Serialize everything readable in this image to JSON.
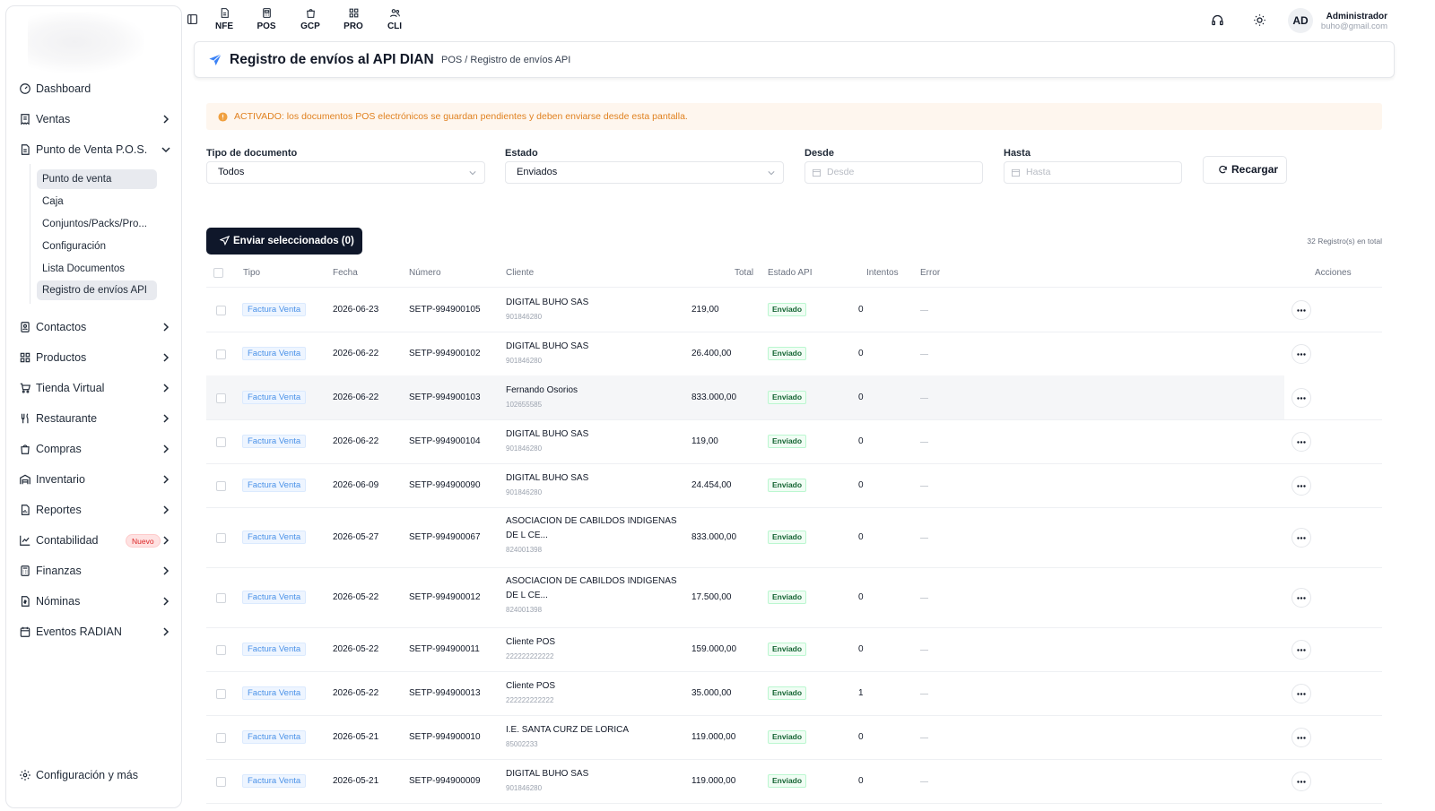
{
  "topbar": {
    "modules": [
      {
        "label": "NFE",
        "icon": "document-icon"
      },
      {
        "label": "POS",
        "icon": "pos-icon"
      },
      {
        "label": "GCP",
        "icon": "bag-icon"
      },
      {
        "label": "PRO",
        "icon": "grid-icon"
      },
      {
        "label": "CLI",
        "icon": "users-icon"
      }
    ],
    "user": {
      "initials": "AD",
      "name": "Administrador",
      "email": "buho@gmail.com"
    }
  },
  "sidebar": {
    "items": [
      {
        "label": "Dashboard",
        "icon": "dashboard-icon"
      },
      {
        "label": "Ventas",
        "icon": "receipt-icon"
      },
      {
        "label": "Punto de Venta P.O.S.",
        "icon": "document-icon",
        "expanded": true
      },
      {
        "label": "Contactos",
        "icon": "contacts-icon"
      },
      {
        "label": "Productos",
        "icon": "grid-icon"
      },
      {
        "label": "Tienda Virtual",
        "icon": "cart-icon"
      },
      {
        "label": "Restaurante",
        "icon": "utensils-icon"
      },
      {
        "label": "Compras",
        "icon": "bag-icon"
      },
      {
        "label": "Inventario",
        "icon": "warehouse-icon"
      },
      {
        "label": "Reportes",
        "icon": "report-icon"
      },
      {
        "label": "Contabilidad",
        "icon": "chart-icon",
        "badge": "Nuevo"
      },
      {
        "label": "Finanzas",
        "icon": "calculator-icon"
      },
      {
        "label": "Nóminas",
        "icon": "payroll-icon"
      },
      {
        "label": "Eventos RADIAN",
        "icon": "calendar-icon"
      }
    ],
    "subitems": [
      "Punto de venta",
      "Caja",
      "Conjuntos/Packs/Pro...",
      "Configuración",
      "Lista Documentos",
      "Registro de envíos API"
    ],
    "footer": "Configuración y más"
  },
  "header": {
    "title": "Registro de envíos al API DIAN",
    "breadcrumb": "POS / Registro de envíos API"
  },
  "alert": {
    "text": "ACTIVADO: los documentos POS electrónicos se guardan pendientes y deben enviarse desde esta pantalla."
  },
  "filters": {
    "tipo_label": "Tipo de documento",
    "tipo_value": "Todos",
    "estado_label": "Estado",
    "estado_value": "Enviados",
    "desde_label": "Desde",
    "desde_placeholder": "Desde",
    "hasta_label": "Hasta",
    "hasta_placeholder": "Hasta",
    "reload_label": "Recargar"
  },
  "actions": {
    "send_label": "Enviar seleccionados (0)",
    "total_label": "32 Registro(s) en total"
  },
  "table": {
    "columns": {
      "tipo": "Tipo",
      "fecha": "Fecha",
      "numero": "Número",
      "cliente": "Cliente",
      "total": "Total",
      "estado": "Estado API",
      "intentos": "Intentos",
      "error": "Error",
      "acciones": "Acciones"
    },
    "rows": [
      {
        "tipo": "Factura Venta",
        "fecha": "2026-06-23",
        "numero": "SETP-994900105",
        "cliente": "DIGITAL BUHO SAS",
        "nit": "901846280",
        "total": "219,00",
        "estado": "Enviado",
        "intentos": "0"
      },
      {
        "tipo": "Factura Venta",
        "fecha": "2026-06-22",
        "numero": "SETP-994900102",
        "cliente": "DIGITAL BUHO SAS",
        "nit": "901846280",
        "total": "26.400,00",
        "estado": "Enviado",
        "intentos": "0"
      },
      {
        "tipo": "Factura Venta",
        "fecha": "2026-06-22",
        "numero": "SETP-994900103",
        "cliente": "Fernando Osorios",
        "nit": "102655585",
        "total": "833.000,00",
        "estado": "Enviado",
        "intentos": "0"
      },
      {
        "tipo": "Factura Venta",
        "fecha": "2026-06-22",
        "numero": "SETP-994900104",
        "cliente": "DIGITAL BUHO SAS",
        "nit": "901846280",
        "total": "119,00",
        "estado": "Enviado",
        "intentos": "0"
      },
      {
        "tipo": "Factura Venta",
        "fecha": "2026-06-09",
        "numero": "SETP-994900090",
        "cliente": "DIGITAL BUHO SAS",
        "nit": "901846280",
        "total": "24.454,00",
        "estado": "Enviado",
        "intentos": "0"
      },
      {
        "tipo": "Factura Venta",
        "fecha": "2026-05-27",
        "numero": "SETP-994900067",
        "cliente": "ASOCIACION DE CABILDOS INDIGENAS DE L CE...",
        "nit": "824001398",
        "total": "833.000,00",
        "estado": "Enviado",
        "intentos": "0"
      },
      {
        "tipo": "Factura Venta",
        "fecha": "2026-05-22",
        "numero": "SETP-994900012",
        "cliente": "ASOCIACION DE CABILDOS INDIGENAS DE L CE...",
        "nit": "824001398",
        "total": "17.500,00",
        "estado": "Enviado",
        "intentos": "0"
      },
      {
        "tipo": "Factura Venta",
        "fecha": "2026-05-22",
        "numero": "SETP-994900011",
        "cliente": "Cliente POS",
        "nit": "222222222222",
        "total": "159.000,00",
        "estado": "Enviado",
        "intentos": "0"
      },
      {
        "tipo": "Factura Venta",
        "fecha": "2026-05-22",
        "numero": "SETP-994900013",
        "cliente": "Cliente POS",
        "nit": "222222222222",
        "total": "35.000,00",
        "estado": "Enviado",
        "intentos": "1"
      },
      {
        "tipo": "Factura Venta",
        "fecha": "2026-05-21",
        "numero": "SETP-994900010",
        "cliente": "I.E. SANTA CURZ DE LORICA",
        "nit": "85002233",
        "total": "119.000,00",
        "estado": "Enviado",
        "intentos": "0"
      },
      {
        "tipo": "Factura Venta",
        "fecha": "2026-05-21",
        "numero": "SETP-994900009",
        "cliente": "DIGITAL BUHO SAS",
        "nit": "901846280",
        "total": "119.000,00",
        "estado": "Enviado",
        "intentos": "0"
      }
    ]
  },
  "colors": {
    "accent": "#3b82f6",
    "dark_button": "#0f172a",
    "alert_bg": "#fef6ee",
    "alert_text": "#e0811f",
    "status_green": "#166534"
  }
}
